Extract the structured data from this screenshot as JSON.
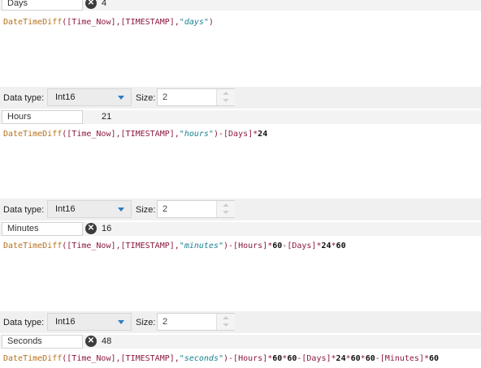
{
  "colors": {
    "function": "#b5701c",
    "field": "#8b1a3c",
    "string": "#1a8090",
    "number": "#111111",
    "dropdown_arrow": "#2c7dc4",
    "clear_icon": "#3c3c3c"
  },
  "icons": {
    "clear": "x-circle-icon",
    "dropdown": "caret-down-icon",
    "spinner": "up-down-spinner-icon"
  },
  "sections": [
    {
      "field_name": "Days",
      "value": "4",
      "formula": {
        "func": "DateTimeDiff",
        "open": "(",
        "arg1": "[Time_Now]",
        "comma1": ",",
        "arg2": "[TIMESTAMP]",
        "comma2": ",",
        "unit": "\"days\"",
        "close": ")"
      }
    },
    {
      "data_type_label": "Data type:",
      "data_type_value": "Int16",
      "size_label": "Size:",
      "size_value": "2",
      "field_name": "Hours",
      "value": "21",
      "formula": {
        "func": "DateTimeDiff",
        "open": "(",
        "arg1": "[Time_Now]",
        "comma1": ",",
        "arg2": "[TIMESTAMP]",
        "comma2": ",",
        "unit": "\"hours\"",
        "close": ")",
        "op1": "-",
        "f1": "[Days]",
        "op2": "*",
        "n1": "24"
      }
    },
    {
      "data_type_label": "Data type:",
      "data_type_value": "Int16",
      "size_label": "Size:",
      "size_value": "2",
      "field_name": "Minutes",
      "value": "16",
      "formula": {
        "func": "DateTimeDiff",
        "open": "(",
        "arg1": "[Time_Now]",
        "comma1": ",",
        "arg2": "[TIMESTAMP]",
        "comma2": ",",
        "unit": "\"minutes\"",
        "close": ")",
        "op1": "-",
        "f1": "[Hours]",
        "op2": "*",
        "n1": "60",
        "op3": "-",
        "f2": "[Days]",
        "op4": "*",
        "n2": "24",
        "op5": "*",
        "n3": "60"
      }
    },
    {
      "data_type_label": "Data type:",
      "data_type_value": "Int16",
      "size_label": "Size:",
      "size_value": "2",
      "field_name": "Seconds",
      "value": "48",
      "formula": {
        "func": "DateTimeDiff",
        "open": "(",
        "arg1": "[Time_Now]",
        "comma1": ",",
        "arg2": "[TIMESTAMP]",
        "comma2": ",",
        "unit": "\"seconds\"",
        "close": ")",
        "op1": "-",
        "f1": "[Hours]",
        "op2": "*",
        "n1": "60",
        "op3": "*",
        "n2": "60",
        "op4": "-",
        "f2": "[Days]",
        "op5": "*",
        "n3": "24",
        "op6": "*",
        "n4": "60",
        "op7": "*",
        "n5": "60",
        "op8": "-",
        "f3": "[Minutes]",
        "op9": "*",
        "n6": "60"
      }
    }
  ]
}
